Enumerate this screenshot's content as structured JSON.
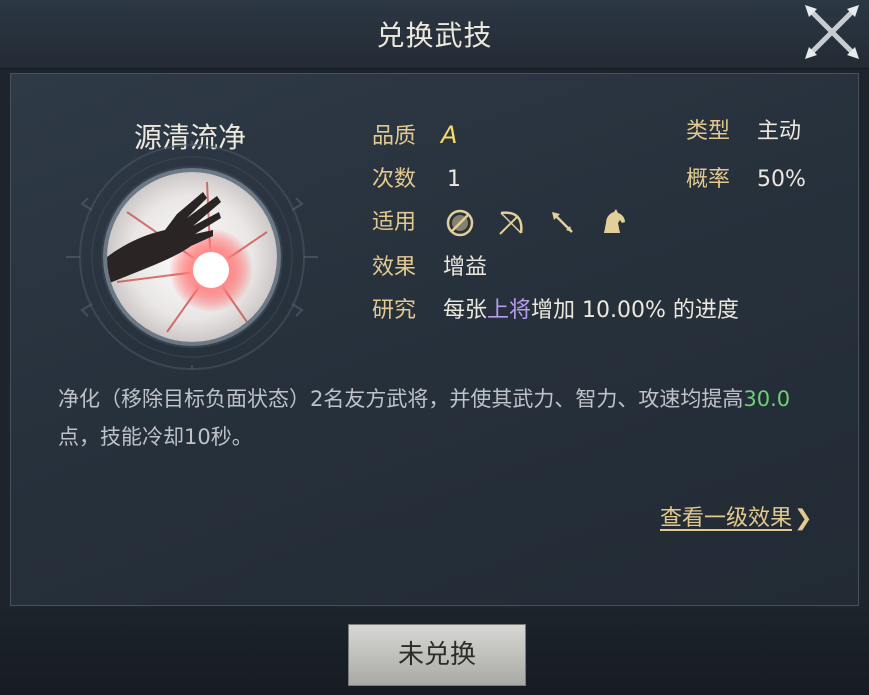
{
  "header": {
    "title": "兑换武技",
    "close_icon": "close-x-icon"
  },
  "skill": {
    "name": "源清流净",
    "icon": "purify-hand-icon"
  },
  "info": {
    "quality": {
      "label": "品质",
      "value": "A"
    },
    "type": {
      "label": "类型",
      "value": "主动"
    },
    "count": {
      "label": "次数",
      "value": "1"
    },
    "rate": {
      "label": "概率",
      "value": "50%"
    },
    "applicable": {
      "label": "适用",
      "icons": [
        "shield-icon",
        "bow-icon",
        "spear-icon",
        "horse-icon"
      ]
    },
    "effect": {
      "label": "效果",
      "value": "增益"
    },
    "research": {
      "label": "研究",
      "prefix": "每张",
      "highlight": "上将",
      "suffix": "增加 10.00% 的进度"
    }
  },
  "description": {
    "part1": "净化（移除目标负面状态）2名友方武将，并使其武力、智力、攻速均提高",
    "value": "30.0",
    "part2": "点，技能冷却10秒。"
  },
  "view_level1": "查看一级效果",
  "view_level1_arrow": "❯",
  "action_button": "未兑换",
  "colors": {
    "accent_gold": "#e2c98f",
    "highlight_purple": "#b79cf0",
    "value_green": "#6fcf74",
    "grade_yellow": "#f2dc6a"
  }
}
